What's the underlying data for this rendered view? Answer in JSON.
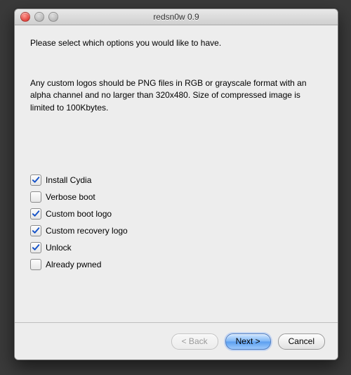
{
  "window": {
    "title": "redsn0w 0.9"
  },
  "heading": "Please select which options you would like to have.",
  "instructions": "Any custom logos should be PNG files in RGB or grayscale format with an alpha channel and no larger than 320x480. Size of compressed image is limited to 100Kbytes.",
  "options": [
    {
      "label": "Install Cydia",
      "checked": true
    },
    {
      "label": "Verbose boot",
      "checked": false
    },
    {
      "label": "Custom boot logo",
      "checked": true
    },
    {
      "label": "Custom recovery logo",
      "checked": true
    },
    {
      "label": "Unlock",
      "checked": true
    },
    {
      "label": "Already pwned",
      "checked": false
    }
  ],
  "buttons": {
    "back": "< Back",
    "next": "Next >",
    "cancel": "Cancel"
  }
}
